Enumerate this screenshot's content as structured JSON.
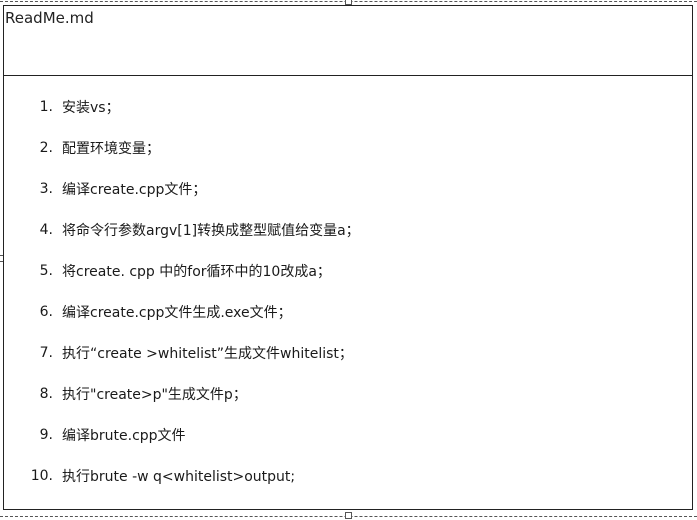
{
  "document": {
    "title": "ReadMe.md",
    "steps": [
      {
        "num": "1.",
        "text": "安装vs；"
      },
      {
        "num": "2.",
        "text": "配置环境变量；"
      },
      {
        "num": "3.",
        "text": "编译create.cpp文件；"
      },
      {
        "num": "4.",
        "text": "将命令行参数argv[1]转换成整型赋值给变量a；"
      },
      {
        "num": "5.",
        "text": "将create. cpp 中的for循环中的10改成a；"
      },
      {
        "num": "6.",
        "text": "编译create.cpp文件生成.exe文件；"
      },
      {
        "num": "7.",
        "text": "执行“create >whitelist”生成文件whitelist；"
      },
      {
        "num": "8.",
        "text": "执行\"create>p\"生成文件p；"
      },
      {
        "num": "9.",
        "text": "编译brute.cpp文件"
      },
      {
        "num": "10.",
        "text": "执行brute -w q<whitelist>output;"
      }
    ]
  }
}
